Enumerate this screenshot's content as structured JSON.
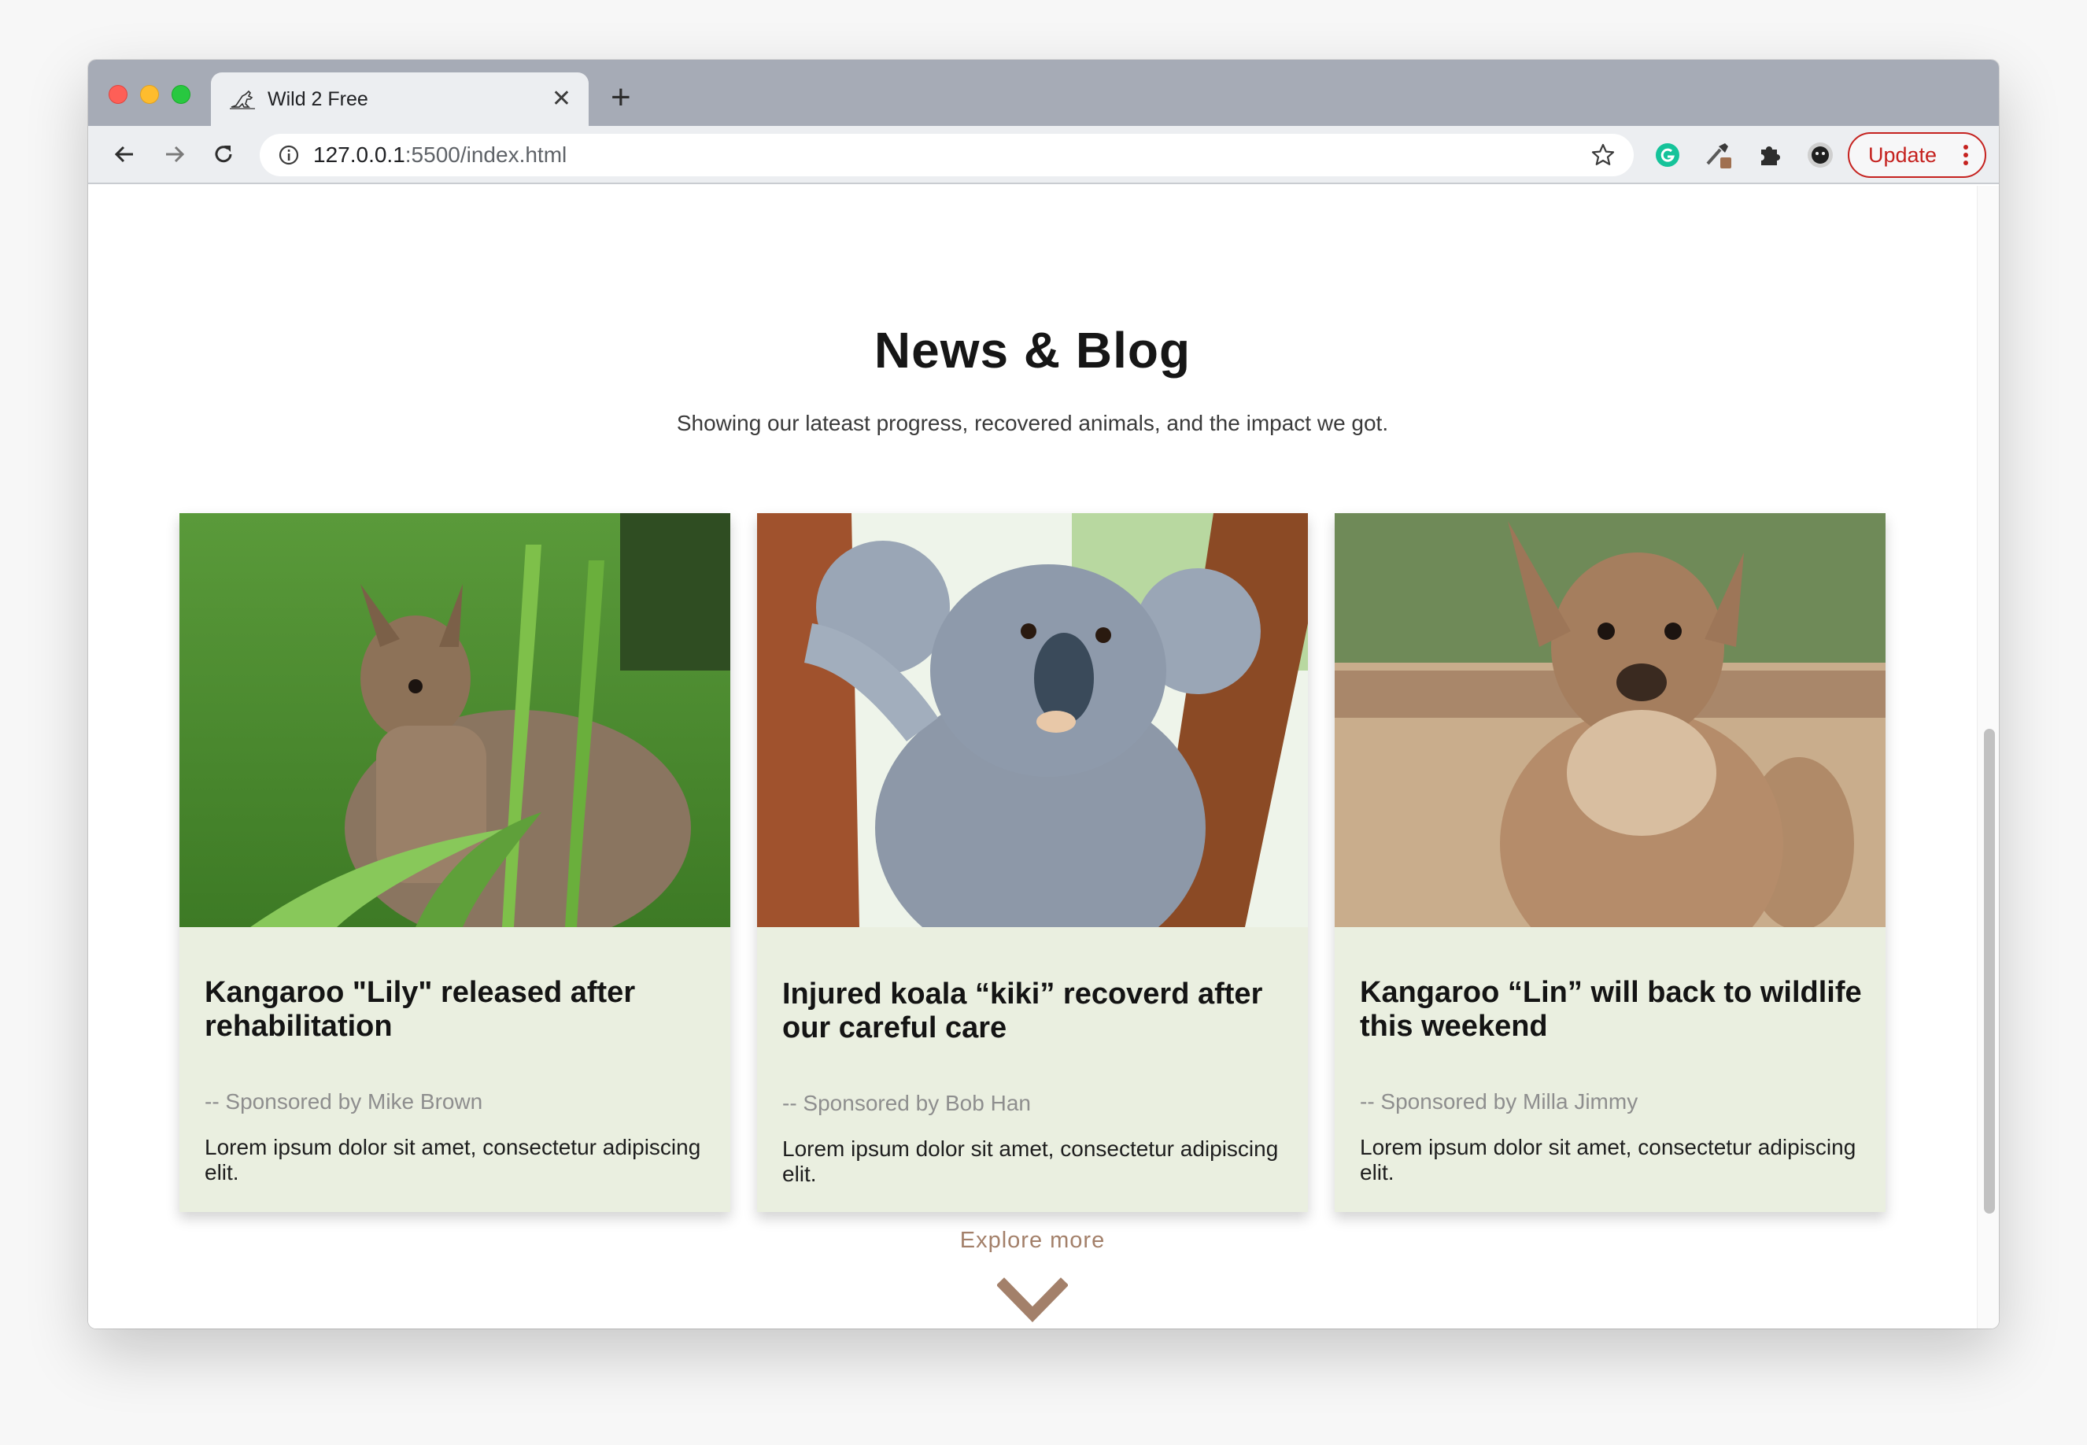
{
  "browser": {
    "tab_title": "Wild 2 Free",
    "url_host": "127.0.0.1",
    "url_rest": ":5500/index.html",
    "update_label": "Update",
    "accent_update": "#c5221f"
  },
  "section": {
    "title": "News & Blog",
    "subtitle": "Showing our lateast progress, recovered animals, and the impact we got."
  },
  "cards": [
    {
      "image": "kangaroo-in-grass",
      "title": "Kangaroo \"Lily\" released after rehabilitation",
      "sponsor": "-- Sponsored by Mike Brown",
      "body": "Lorem ipsum dolor sit amet, consectetur adipiscing elit."
    },
    {
      "image": "koala-on-tree",
      "title": "Injured koala “kiki” recoverd after our careful care",
      "sponsor": "-- Sponsored by Bob Han",
      "body": "Lorem ipsum dolor sit amet, consectetur adipiscing elit."
    },
    {
      "image": "kangaroo-close-up",
      "title": "Kangaroo “Lin” will back to wildlife this weekend",
      "sponsor": "-- Sponsored by Milla Jimmy",
      "body": "Lorem ipsum dolor sit amet, consectetur adipiscing elit."
    }
  ],
  "explore": {
    "label": "Explore more",
    "icon": "chevron-down-icon",
    "color": "#a3806a"
  },
  "colors": {
    "card_bg": "#eaefe0",
    "titlebar": "#a6abb6",
    "toolbar": "#eceef1"
  }
}
